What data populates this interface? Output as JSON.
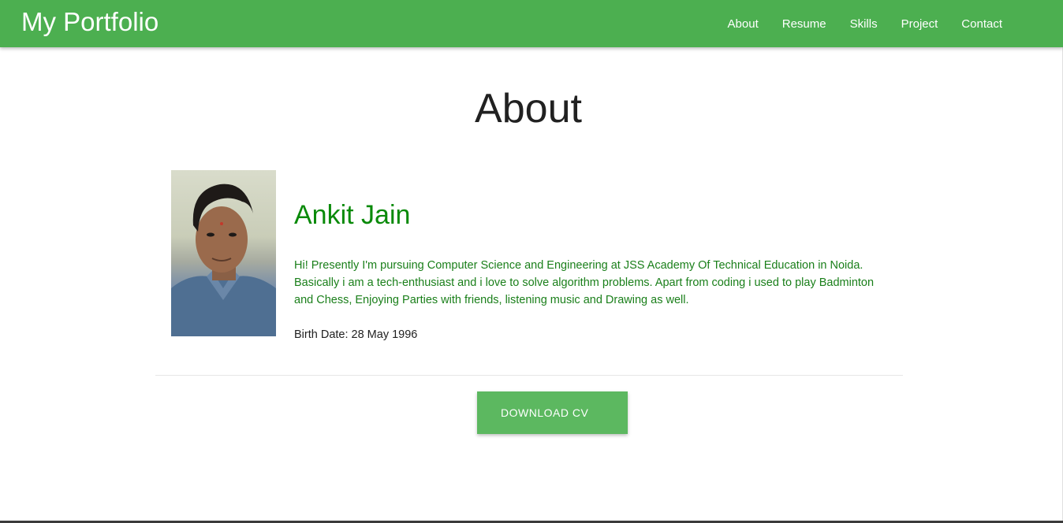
{
  "header": {
    "brand": "My Portfolio",
    "nav": [
      {
        "label": "About"
      },
      {
        "label": "Resume"
      },
      {
        "label": "Skills"
      },
      {
        "label": "Project"
      },
      {
        "label": "Contact"
      }
    ]
  },
  "about": {
    "title": "About",
    "name": "Ankit Jain",
    "bio": "Hi! Presently I'm pursuing Computer Science and Engineering at JSS Academy Of Technical Education in Noida. Basically i am a tech-enthusiast and i love to solve algorithm problems. Apart from coding i used to play Badminton and Chess, Enjoying Parties with friends, listening music and Drawing as well.",
    "birth_date": "Birth Date: 28 May 1996",
    "download_label": "DOWNLOAD CV"
  },
  "colors": {
    "navbar": "#4caf50",
    "name_text": "#0a8a0a",
    "bio_text": "#1a7f1a",
    "button": "#5cb860"
  }
}
